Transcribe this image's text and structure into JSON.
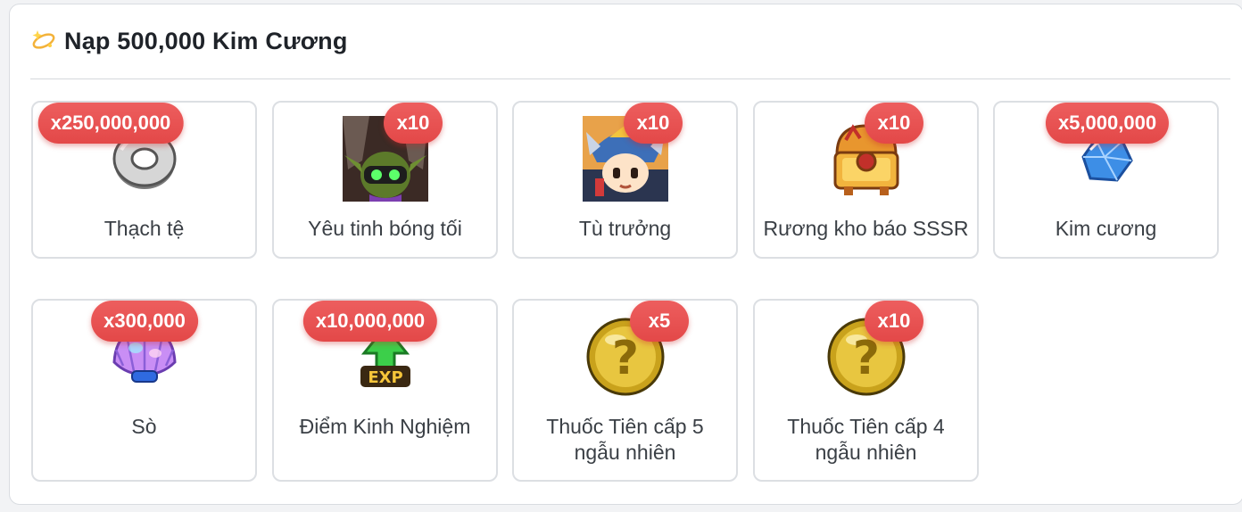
{
  "header": {
    "icon": "sparkle-ring-icon",
    "title": "Nạp 500,000 Kim Cương"
  },
  "colors": {
    "badge": "#e85353",
    "card_border": "#dcdfe3",
    "text": "#3a3f45",
    "title": "#1f2329"
  },
  "rewards": [
    {
      "name": "Thạch tệ",
      "qty": "x250,000,000",
      "icon": "stone-coin-icon"
    },
    {
      "name": "Yêu tinh bóng tối",
      "qty": "x10",
      "icon": "dark-goblin-icon"
    },
    {
      "name": "Tù trưởng",
      "qty": "x10",
      "icon": "chieftain-hero-icon"
    },
    {
      "name": "Rương kho báo SSSR",
      "qty": "x10",
      "icon": "treasure-chest-icon"
    },
    {
      "name": "Kim cương",
      "qty": "x5,000,000",
      "icon": "diamond-icon"
    },
    {
      "name": "Sò",
      "qty": "x300,000",
      "icon": "seashell-icon"
    },
    {
      "name": "Điểm Kinh Nghiệm",
      "qty": "x10,000,000",
      "icon": "exp-arrow-icon"
    },
    {
      "name": "Thuốc Tiên cấp 5 ngẫu nhiên",
      "qty": "x5",
      "icon": "mystery-potion-icon"
    },
    {
      "name": "Thuốc Tiên cấp 4 ngẫu nhiên",
      "qty": "x10",
      "icon": "mystery-potion-icon"
    }
  ]
}
